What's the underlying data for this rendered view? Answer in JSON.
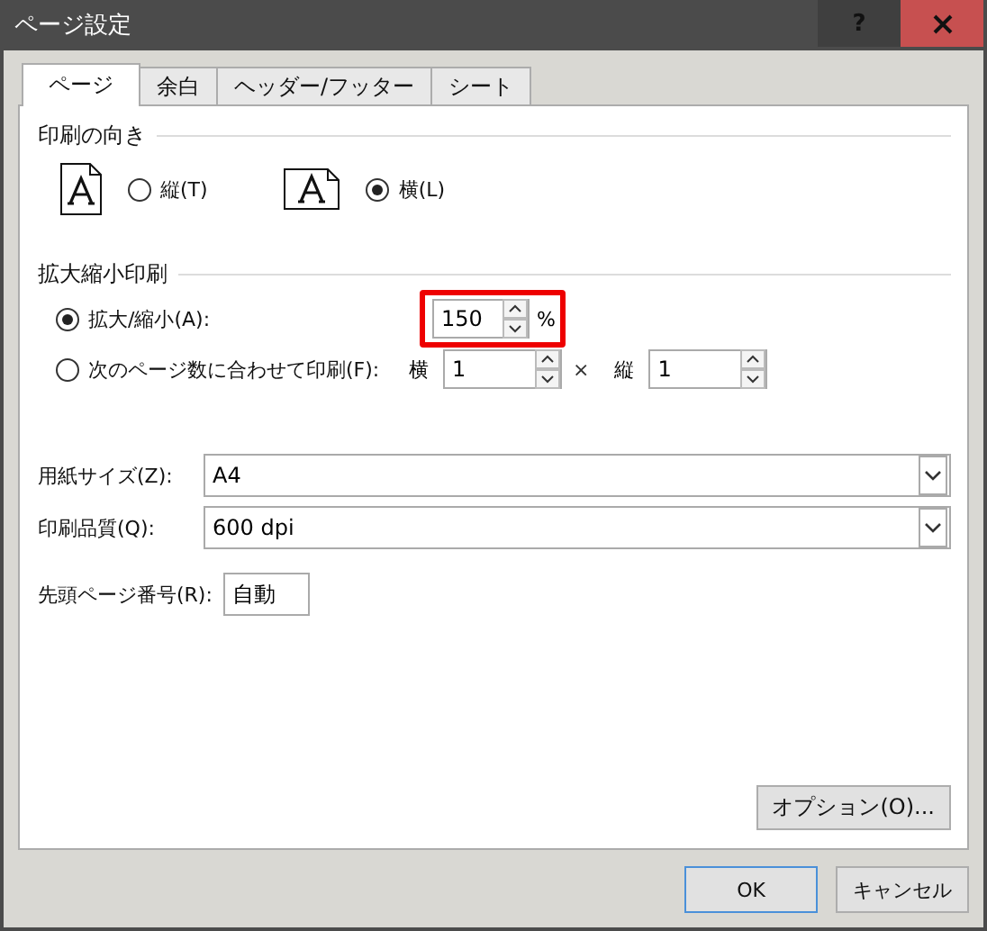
{
  "window": {
    "title": "ページ設定",
    "help_button": "?"
  },
  "tabs": [
    {
      "label": "ページ",
      "selected": true
    },
    {
      "label": "余白",
      "selected": false
    },
    {
      "label": "ヘッダー/フッター",
      "selected": false
    },
    {
      "label": "シート",
      "selected": false
    }
  ],
  "orientation": {
    "heading": "印刷の向き",
    "options": [
      {
        "kind": "portrait",
        "label": "縦(T)",
        "selected": false
      },
      {
        "kind": "landscape",
        "label": "横(L)",
        "selected": true
      }
    ]
  },
  "scaling": {
    "heading": "拡大縮小印刷",
    "options": [
      {
        "kind": "percent",
        "label": "拡大/縮小(A):",
        "selected": true,
        "value": "150",
        "unit": "%",
        "highlighted": true
      },
      {
        "kind": "fit",
        "label": "次のページ数に合わせて印刷(F):",
        "selected": false,
        "wide_label": "横",
        "wide_value": "1",
        "times": "×",
        "tall_label": "縦",
        "tall_value": "1"
      }
    ]
  },
  "paper_size": {
    "label": "用紙サイズ(Z):",
    "value": "A4"
  },
  "print_quality": {
    "label": "印刷品質(Q):",
    "value": "600 dpi"
  },
  "first_page_number": {
    "label": "先頭ページ番号(R):",
    "value": "自動"
  },
  "options_button": "オプション(O)...",
  "buttons": [
    {
      "kind": "default",
      "label": "OK"
    },
    {
      "kind": "normal",
      "label": "キャンセル"
    }
  ]
}
